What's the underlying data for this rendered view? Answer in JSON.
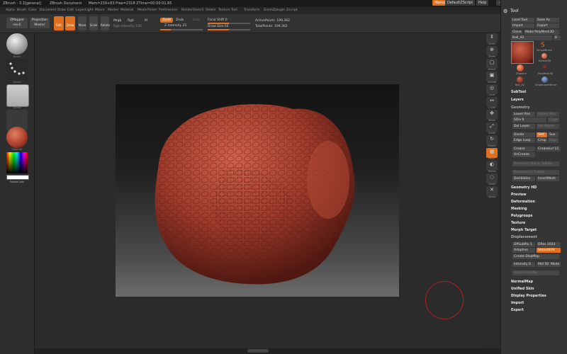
{
  "titlebar": {
    "app": "ZBrush - 3.1[general]",
    "doc": "ZBrush Document",
    "stats": "Mem=239+83  Free=2318  ZTime=00:00:01.85",
    "menus_btn": "Menus",
    "script_btn": "DefaultZScript",
    "help_btn": "Help"
  },
  "menubar": [
    "Alpha",
    "Brush",
    "Color",
    "Document",
    "Draw",
    "Edit",
    "Layer",
    "Light",
    "Macro",
    "Marker",
    "Material",
    "Movie",
    "Picker",
    "Preferences",
    "Render",
    "Stencil",
    "Stroke",
    "Texture",
    "Tool",
    "Transform",
    "Zoom",
    "Zplugin",
    "Zscript"
  ],
  "shelf": {
    "zmapper": "ZMapper",
    "zmapper_rev": "rev-E",
    "projection_master": "Projection Master",
    "edit": "Edit",
    "draw": "Draw",
    "move": "Move",
    "scale": "Scale",
    "rotate": "Rotate",
    "mrgb": "Mrgb",
    "rgb": "Rgb",
    "m": "M",
    "rgb_intensity": "Rgb Intensity 100",
    "zadd": "Zadd",
    "zsub": "Zsub",
    "zcut": "Zcut",
    "z_intensity": "Z Intensity 25",
    "focal_shift": "Focal Shift 0",
    "draw_size": "Draw Size 64",
    "active_points": "ActivePoints: 199,362",
    "total_points": "TotalPoints: 199,362"
  },
  "leftshelf": {
    "thumbs": [
      "Brush",
      "Stroke",
      "Alpha",
      "Texture",
      "Material"
    ],
    "switch_color": "SwitchColor"
  },
  "rightshelf": [
    "Scroll",
    "Zoom",
    "Actual",
    "AAHalf",
    "Local",
    "L.Sym",
    "Move",
    "Scale",
    "Rotate",
    "PolyF",
    "Transp",
    "Ghost",
    "Xpose"
  ],
  "toolpanel": {
    "title": "Tool",
    "load_tool": "Load Tool",
    "save_as": "Save As",
    "import": "Import",
    "export": "Export",
    "clone": "Clone",
    "make_polymesh": "Make PolyMesh3D",
    "current_tool": "Ball_42",
    "tool_count": "8",
    "tools": [
      "Ball_42",
      "SimpleBrush",
      "Sphere3D",
      "ZSphere",
      "PolyMesh3D",
      "Ball_42",
      "SingleLayerBrush"
    ],
    "subtool": "SubTool",
    "layers": "Layers",
    "geometry": "Geometry",
    "lower_res": "Lower Res",
    "higher_res": "Higher Res",
    "sdiv": "SDiv 6",
    "cage": "Cage",
    "del_lower": "Del Lower",
    "del_higher": "Del Higher",
    "divide": "Divide",
    "smt": "Smt",
    "suv": "Suv",
    "edge_loop": "Edge Loop",
    "crisp": "Crisp",
    "disp": "Disp",
    "crease": "Crease",
    "crease_lvl": "CreaseLvl 15",
    "uncrease": "UnCrease",
    "reproject": "Reproject Higher Subdiv",
    "reconstruct": "Reconstruct Subdiv",
    "delhidden": "DelHidden",
    "insertmesh": "InsertMesh",
    "sections": [
      "Geometry HD",
      "Preview",
      "Deformation",
      "Masking",
      "Polygroups",
      "Texture",
      "Morph Target"
    ],
    "displacement": "Displacement",
    "dpsubpix": "DPSubPix 1",
    "dres": "DRes 1024",
    "adaptive": "Adaptive",
    "smooth_uv": "SmoothUV",
    "create_dispmap": "Create DispMap",
    "intensity": "Intensity 0",
    "mid": "Mid 50",
    "mode": "Mode",
    "apply_disp": "Apply DispMap",
    "sections2": [
      "NormalMap",
      "Unified Skin",
      "Display Properties",
      "Import",
      "Export"
    ]
  },
  "colors": {
    "accent": "#e07020",
    "panel": "#353535",
    "model": "#9c3a2b"
  }
}
